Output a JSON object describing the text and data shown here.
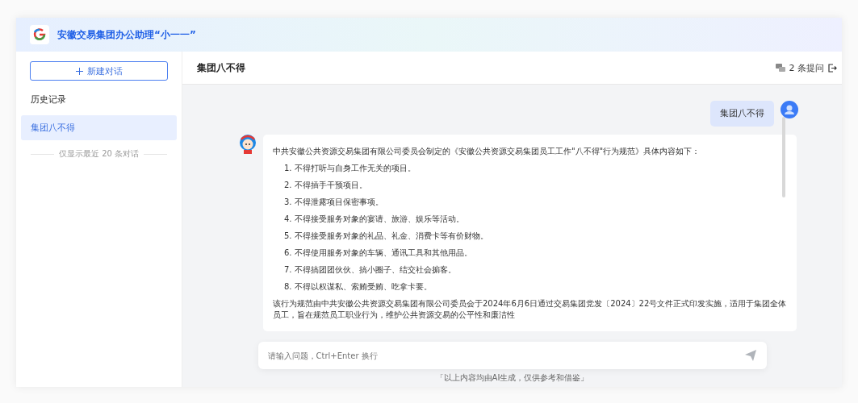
{
  "header": {
    "title": "安徽交易集团办公助理“小一一”"
  },
  "sidebar": {
    "new_chat": "新建对话",
    "history_label": "历史记录",
    "items": [
      {
        "label": "集团八不得",
        "selected": true
      }
    ],
    "footer_note": "仅显示最近 20 条对话"
  },
  "chat": {
    "title": "集团八不得",
    "question_count": "2 条提问",
    "messages": [
      {
        "kind": "user",
        "text": "集团八不得"
      },
      {
        "kind": "bot",
        "intro": "中共安徽公共资源交易集团有限公司委员会制定的《安徽公共资源交易集团员工工作\"八不得\"行为规范》具体内容如下：",
        "items": [
          "1. 不得打听与自身工作无关的项目。",
          "2. 不得插手干预项目。",
          "3. 不得泄露项目保密事项。",
          "4. 不得接受服务对象的宴请、旅游、娱乐等活动。",
          "5. 不得接受服务对象的礼品、礼金、消费卡等有价财物。",
          "6. 不得使用服务对象的车辆、通讯工具和其他用品。",
          "7. 不得搞团团伙伙、搞小圈子、结交社会掮客。",
          "8. 不得以权谋私、索贿受贿、吃拿卡要。"
        ],
        "outro": "该行为规范由中共安徽公共资源交易集团有限公司委员会于2024年6月6日通过交易集团党发〔2024〕22号文件正式印发实施，适用于集团全体员工，旨在规范员工职业行为，维护公共资源交易的公平性和廉洁性"
      }
    ],
    "input_placeholder": "请输入问题，Ctrl+Enter 换行",
    "disclaimer": "「以上内容均由AI生成，仅供参考和借鉴」"
  }
}
